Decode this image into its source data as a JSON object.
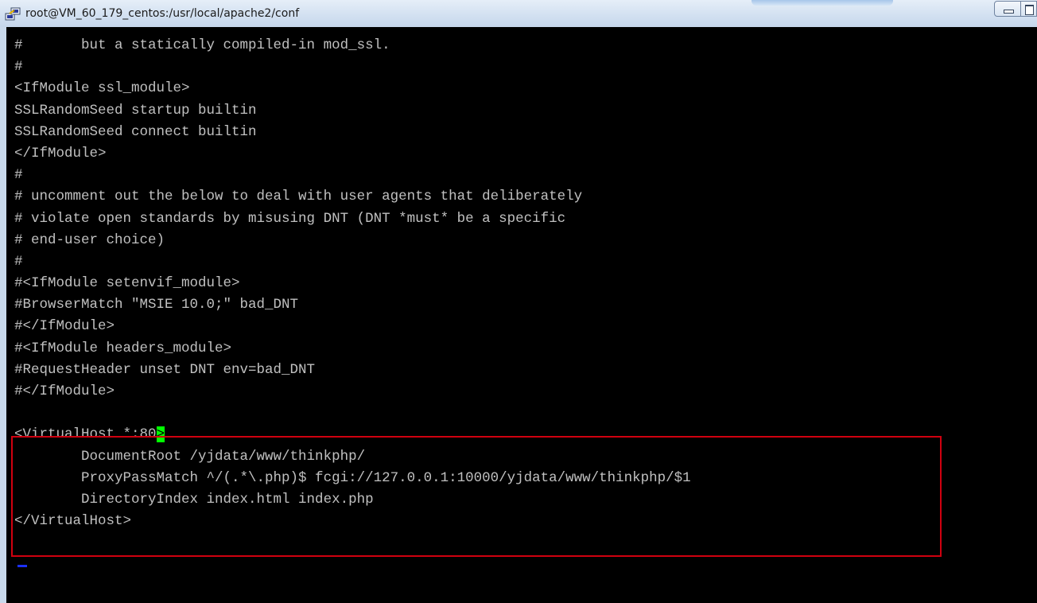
{
  "window": {
    "title": "root@VM_60_179_centos:/usr/local/apache2/conf"
  },
  "terminal": {
    "lines": [
      "#       but a statically compiled-in mod_ssl.",
      "#",
      "<IfModule ssl_module>",
      "SSLRandomSeed startup builtin",
      "SSLRandomSeed connect builtin",
      "</IfModule>",
      "#",
      "# uncomment out the below to deal with user agents that deliberately",
      "# violate open standards by misusing DNT (DNT *must* be a specific",
      "# end-user choice)",
      "#",
      "#<IfModule setenvif_module>",
      "#BrowserMatch \"MSIE 10.0;\" bad_DNT",
      "#</IfModule>",
      "#<IfModule headers_module>",
      "#RequestHeader unset DNT env=bad_DNT",
      "#</IfModule>",
      "",
      "<VirtualHost *:80",
      "        DocumentRoot /yjdata/www/thinkphp/",
      "        ProxyPassMatch ^/(.*\\.php)$ fcgi://127.0.0.1:10000/yjdata/www/thinkphp/$1",
      "        DirectoryIndex index.html index.php",
      "</VirtualHost>"
    ],
    "cursor_char": ">"
  },
  "colors": {
    "terminal_background": "#000000",
    "terminal_text": "#c0c0c0",
    "cursor": "#00ff00",
    "highlight_border": "#d0000f"
  }
}
